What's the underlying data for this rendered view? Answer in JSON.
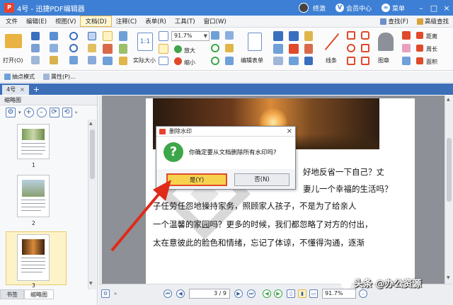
{
  "titlebar": {
    "title": "4号 - 迅捷PDF编辑器",
    "user": "终激",
    "vip": "会员中心",
    "menu": "菜单"
  },
  "menu": {
    "items": [
      "文件",
      "编辑(E)",
      "视图(V)",
      "文档(D)",
      "注释(C)",
      "表单(R)",
      "工具(T)",
      "窗口(W)"
    ],
    "right_items": [
      "查找(F)",
      "高级查找"
    ]
  },
  "ribbon": {
    "open": "打开(O)",
    "actual_size": "实际大小",
    "zoom_value": "91.7%",
    "zoom_in": "放大",
    "zoom_out": "缩小",
    "edit_form": "编辑表单",
    "line": "线条",
    "stamp": "图章",
    "distance": "距离",
    "perimeter": "周长",
    "area": "面积"
  },
  "subbar": {
    "snapshot": "抽点模式",
    "properties": "属性(P)..."
  },
  "tabs": {
    "doc_tab": "4号",
    "close": "×",
    "add": "+"
  },
  "leftpanel": {
    "title": "缩略图",
    "thumb_numbers": [
      "1",
      "2",
      "3"
    ],
    "bottom_tabs": [
      "书签",
      "缩略图"
    ]
  },
  "document": {
    "lines": [
      "好地反省一下自己？丈",
      "妻儿一个幸福的生活吗？",
      "子任劳任怨地操持家务，照顾家人孩子，不是为了给亲人",
      "一个温馨的家园吗？更多的时候，我们都忽略了对方的付出，",
      "太在意彼此的脸色和情绪，忘记了体谅，不懂得沟通，逐渐"
    ]
  },
  "dialog": {
    "title": "删除水印",
    "close": "×",
    "message": "你确定要从文档删除所有水印吗?",
    "yes": "是(Y)",
    "no": "否(N)",
    "q_mark": "?"
  },
  "status": {
    "page": "3 / 9",
    "zoom": "91.7%"
  },
  "footer_watermark": "头条 @办公资源",
  "footer_watermark_bg": "掌中IT发烧友圈"
}
